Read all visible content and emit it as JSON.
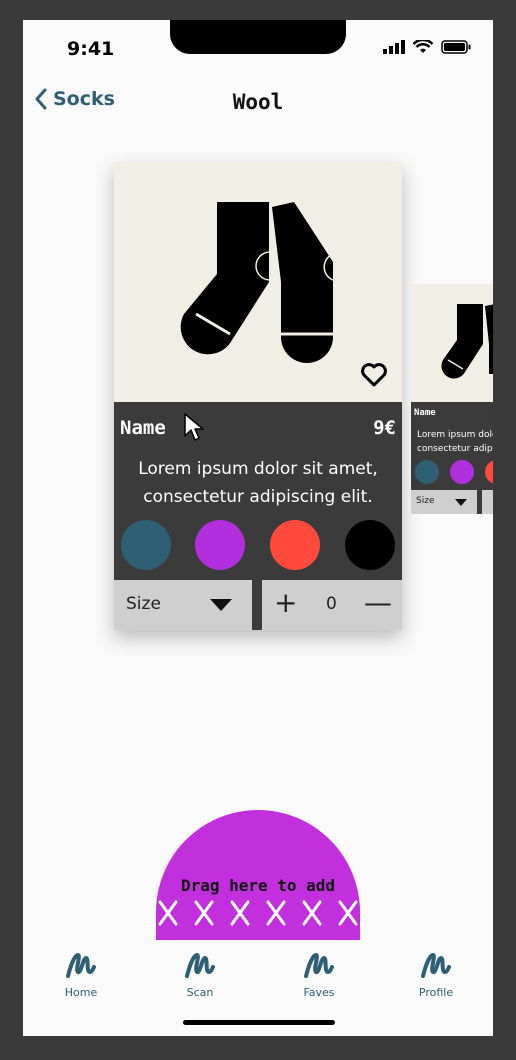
{
  "status_bar": {
    "time": "9:41"
  },
  "nav": {
    "back_label": "Socks",
    "title": "Wool"
  },
  "product": {
    "name": "Name",
    "price": "9€",
    "description_line1": "Lorem ipsum dolor sit amet,",
    "description_line2": "consectetur adipiscing elit.",
    "colors": [
      "#2f5f74",
      "#b12fdc",
      "#ff4a3d",
      "#000000"
    ],
    "size_label": "Size",
    "quantity": "0",
    "plus_label": "+",
    "minus_label": "—"
  },
  "next_product": {
    "name": "Name",
    "description_line1": "Lorem ipsum dolor sit amet,",
    "description_line2": "consectetur adipiscing elit.",
    "size_label": "Size"
  },
  "drop_zone": {
    "label": "Drag here to add"
  },
  "tabs": [
    {
      "label": "Home",
      "icon": "squiggle-icon"
    },
    {
      "label": "Scan",
      "icon": "squiggle-icon"
    },
    {
      "label": "Faves",
      "icon": "squiggle-icon"
    },
    {
      "label": "Profile",
      "icon": "squiggle-icon"
    }
  ],
  "colors": {
    "accent": "#2f5f74",
    "card_bg": "#3b3b3b",
    "drop_zone": "#c22fdc",
    "image_bg": "#f1eee6"
  }
}
